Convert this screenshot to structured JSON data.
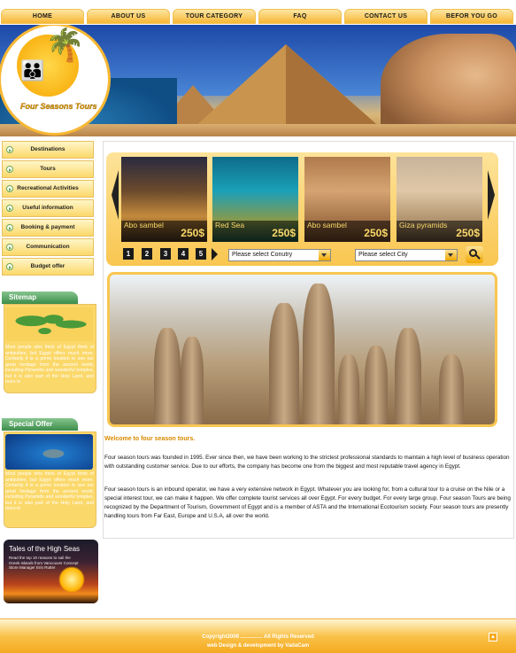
{
  "nav": {
    "items": [
      "HOME",
      "ABOUT US",
      "TOUR CATEGORY",
      "FAQ",
      "CONTACT US",
      "BEFOR YOU GO"
    ]
  },
  "logo": {
    "text": "Four Seasons Tours"
  },
  "sidebar": {
    "items": [
      "Destinations",
      "Tours",
      "Recreational Activities",
      "Useful information",
      "Booking & payment",
      "Communication",
      "Budget offer"
    ]
  },
  "sitemap": {
    "title": "Sitemap",
    "text": "Most people who think of Egypt think of antiquities, but Egypt offers much more. Certainly it is a prime location to see our great heritage from the ancient world, including Pyramids and wonderful temples, but it is also part of the Holy Land, and tours to"
  },
  "special_offer": {
    "title": "Special Offer",
    "text": "Most people who think of Egypt think of antiquities, but Egypt offers much more. Certainly it is a prime location to see our great heritage from the ancient world, including Pyramids and wonderful temples, but it is also part of the Holy Land, and tours to"
  },
  "promo": {
    "title": "Tales of the High Seas",
    "subtitle": "Read the top 10 reasons to sail the Greek Islands from Vancouver Concept Store Manager Erin Rutter"
  },
  "tours": [
    {
      "name": "Abo sambel",
      "price": "250$"
    },
    {
      "name": "Red Sea",
      "price": "250$"
    },
    {
      "name": "Abo sambel",
      "price": "250$"
    },
    {
      "name": "Giza pyramids",
      "price": "250$"
    }
  ],
  "pagination": [
    "1",
    "2",
    "3",
    "4",
    "5"
  ],
  "search": {
    "country": "Please select Conutry",
    "city": "Please select City"
  },
  "content": {
    "welcome": "Welcome to four season tours.",
    "p1": "Four season tours was founded in 1995. Ever since then, we have been working to the strictest professional standards to maintain a high level of business operation with outstanding customer service. Due to our efforts, the company has become one from the biggest and most reputable travel agency in Egypt.",
    "p2": "Four season tours is an inbound operator, we have a very extensive network in Egypt. Whatever you are looking for, from a cultural tour to a cruise on the Nile or a special interest tour, we can make it happen. We offer complete tourist services all over Egypt. For every budget. For every large group. Four season Tours are being recognized by the Department of Tourism, Government of Egypt and is a member of ASTA and the International Ecotourism society. Four season tours are presently handling tours from Far East, Europe and U.S.A, all over the world."
  },
  "footer": {
    "copyright": "Copyright2008 ............... All Rights Reserved",
    "credit": "web Design & development by VadaCam"
  },
  "colors": {
    "accent": "#f7b733",
    "green": "#3c8d4a",
    "welcome": "#d98a00"
  }
}
